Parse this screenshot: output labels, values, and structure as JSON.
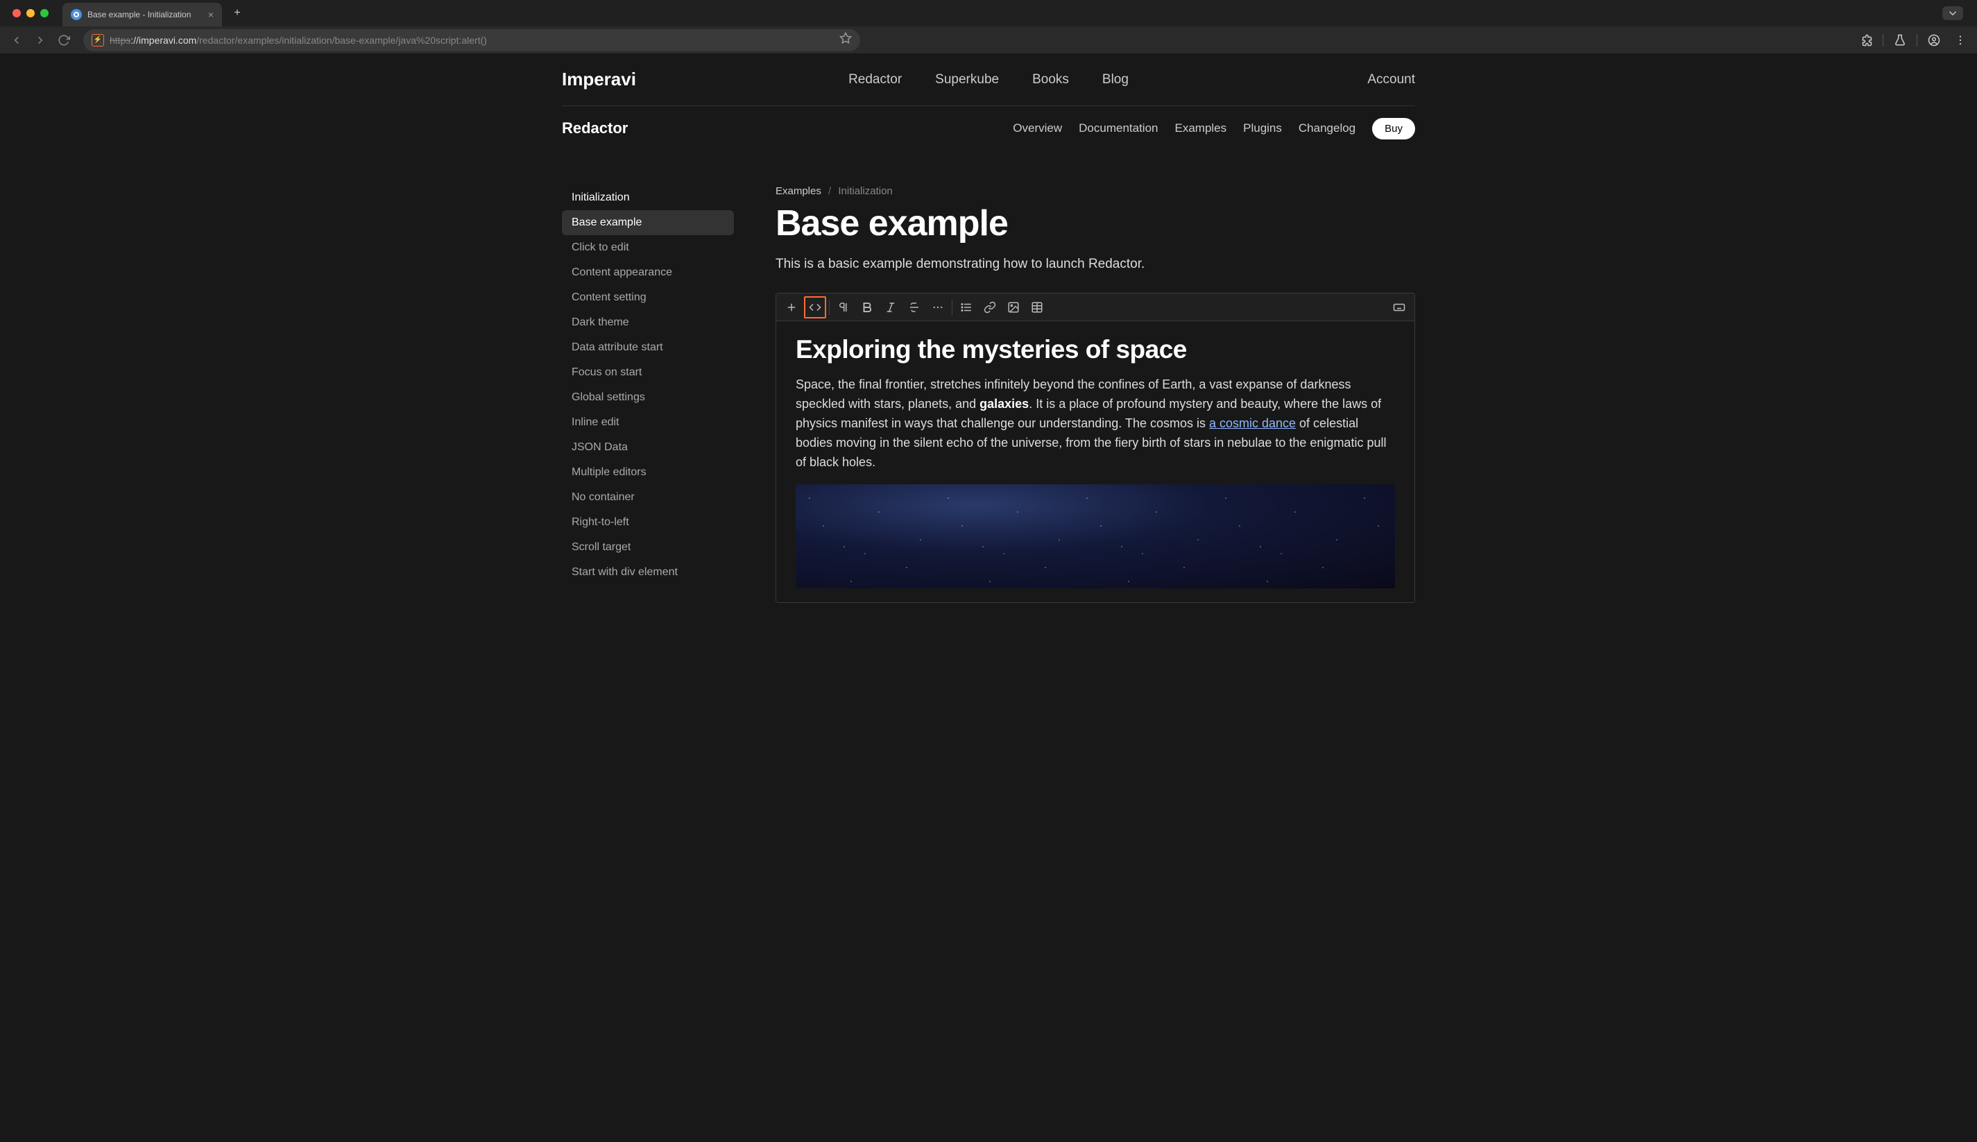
{
  "browser": {
    "tab_title": "Base example - Initialization",
    "url_https": "https",
    "url_domain": "://imperavi.com",
    "url_path": "/redactor/examples/initialization/base-example/java%20script:alert()"
  },
  "top_nav": {
    "brand": "Imperavi",
    "links": [
      "Redactor",
      "Superkube",
      "Books",
      "Blog"
    ],
    "account": "Account"
  },
  "sub_nav": {
    "brand": "Redactor",
    "links": [
      "Overview",
      "Documentation",
      "Examples",
      "Plugins",
      "Changelog"
    ],
    "buy": "Buy"
  },
  "sidebar": {
    "heading": "Initialization",
    "items": [
      "Base example",
      "Click to edit",
      "Content appearance",
      "Content setting",
      "Dark theme",
      "Data attribute start",
      "Focus on start",
      "Global settings",
      "Inline edit",
      "JSON Data",
      "Multiple editors",
      "No container",
      "Right-to-left",
      "Scroll target",
      "Start with div element"
    ],
    "active_index": 0
  },
  "breadcrumb": {
    "link": "Examples",
    "current": "Initialization"
  },
  "page": {
    "title": "Base example",
    "description": "This is a basic example demonstrating how to launch Redactor."
  },
  "editor": {
    "heading": "Exploring the mysteries of space",
    "para_1_part1": "Space, the final frontier, stretches infinitely beyond the confines of Earth, a vast expanse of darkness speckled with stars, planets, and ",
    "para_1_bold": "galaxies",
    "para_1_part2": ". It is a place of profound mystery and beauty, where the laws of physics manifest in ways that challenge our understanding. The cosmos is ",
    "para_1_link": "a cosmic dance",
    "para_1_part3": " of celestial bodies moving in the silent echo of the universe, from the fiery birth of stars in nebulae to the enigmatic pull of black holes."
  }
}
